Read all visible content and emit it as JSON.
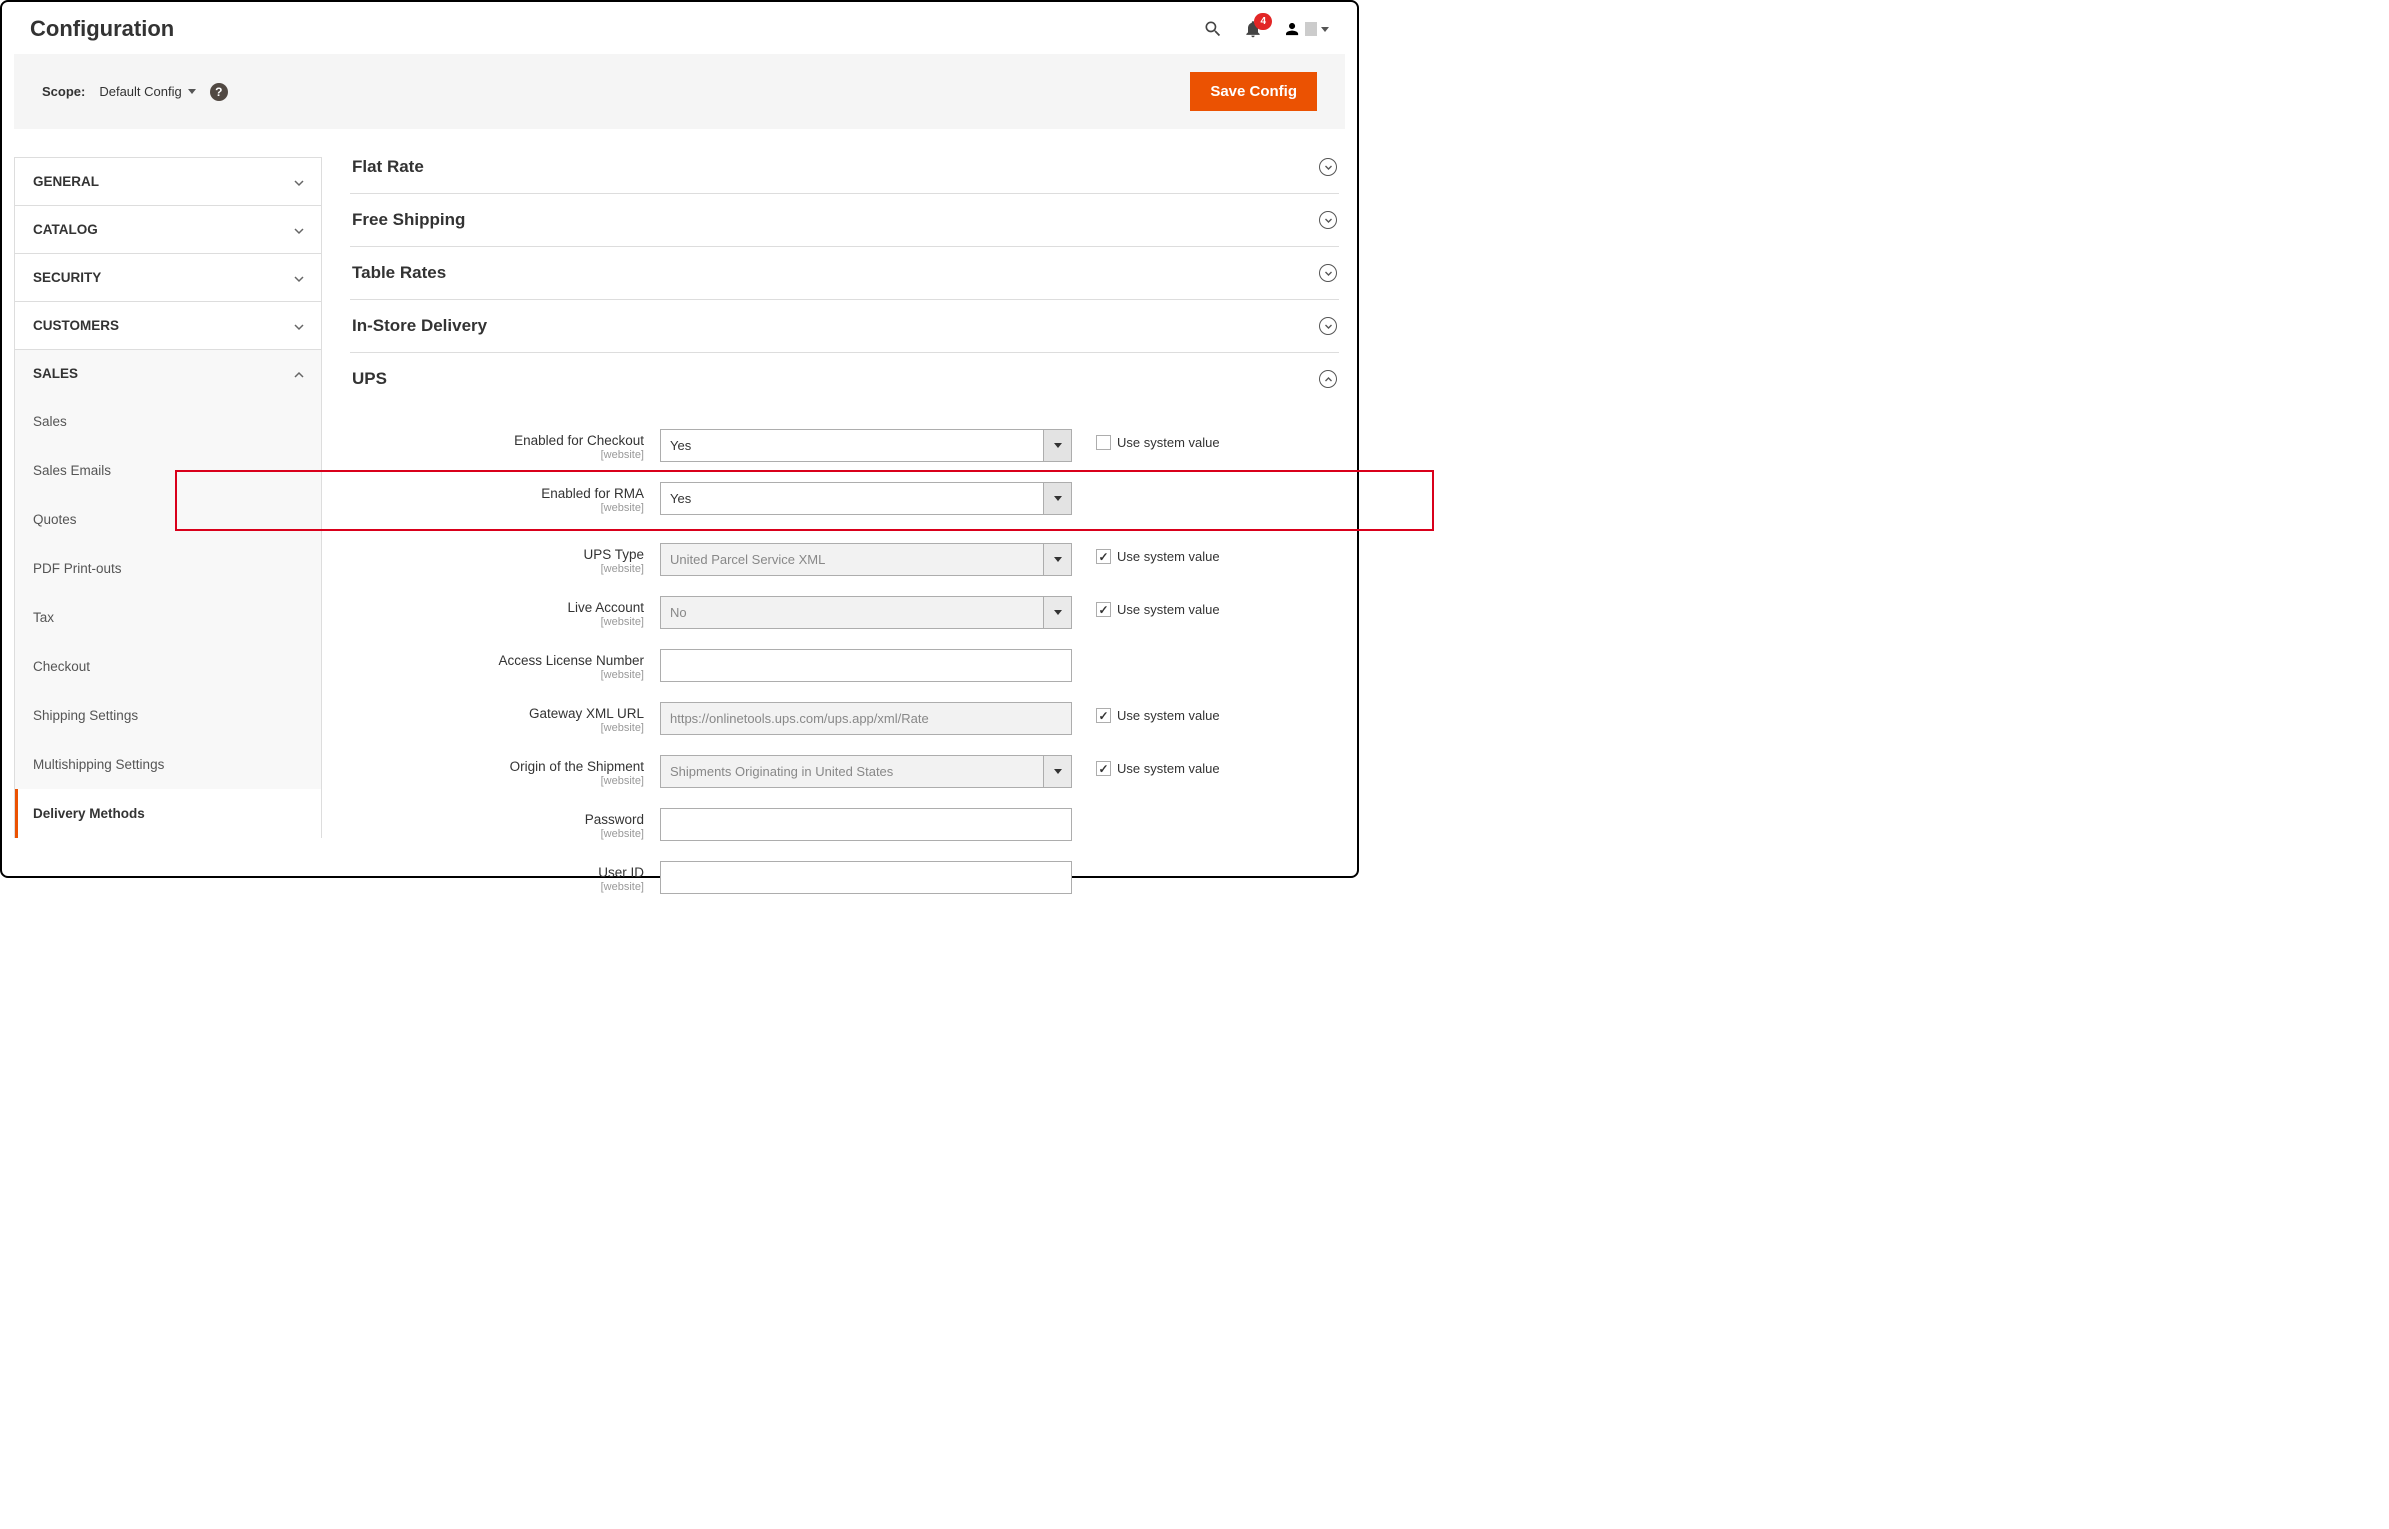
{
  "header": {
    "title": "Configuration",
    "notification_count": "4"
  },
  "scope": {
    "label": "Scope:",
    "value": "Default Config",
    "save_button": "Save Config"
  },
  "sidebar": {
    "sections": [
      {
        "label": "GENERAL",
        "expanded": false
      },
      {
        "label": "CATALOG",
        "expanded": false
      },
      {
        "label": "SECURITY",
        "expanded": false
      },
      {
        "label": "CUSTOMERS",
        "expanded": false
      },
      {
        "label": "SALES",
        "expanded": true
      }
    ],
    "subitems": [
      "Sales",
      "Sales Emails",
      "Quotes",
      "PDF Print-outs",
      "Tax",
      "Checkout",
      "Shipping Settings",
      "Multishipping Settings",
      "Delivery Methods"
    ]
  },
  "main": {
    "sections": [
      "Flat Rate",
      "Free Shipping",
      "Table Rates",
      "In-Store Delivery",
      "UPS"
    ],
    "scope_tag": "[website]",
    "use_system": "Use system value",
    "fields": {
      "enabled_checkout": {
        "label": "Enabled for Checkout",
        "value": "Yes"
      },
      "enabled_rma": {
        "label": "Enabled for RMA",
        "value": "Yes"
      },
      "ups_type": {
        "label": "UPS Type",
        "value": "United Parcel Service XML"
      },
      "live_account": {
        "label": "Live Account",
        "value": "No"
      },
      "access_license": {
        "label": "Access License Number",
        "value": ""
      },
      "gateway_url": {
        "label": "Gateway XML URL",
        "value": "https://onlinetools.ups.com/ups.app/xml/Rate"
      },
      "origin": {
        "label": "Origin of the Shipment",
        "value": "Shipments Originating in United States"
      },
      "password": {
        "label": "Password",
        "value": ""
      },
      "user_id": {
        "label": "User ID",
        "value": ""
      }
    }
  }
}
